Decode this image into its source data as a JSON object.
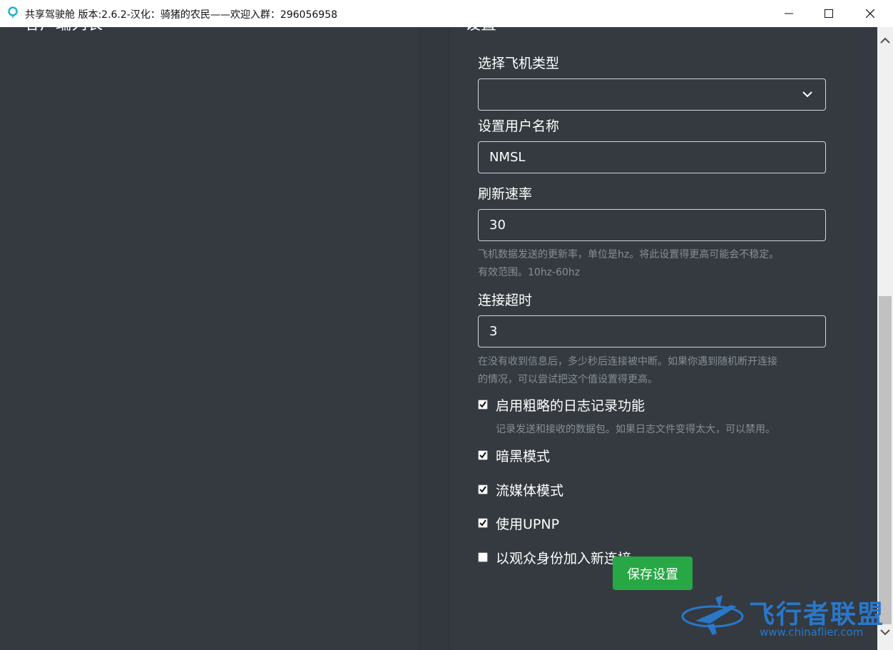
{
  "window": {
    "title": "共享驾驶舱 版本:2.6.2-汉化：骑猪的农民——欢迎入群：296056958",
    "minimize_icon": "minimize-icon",
    "maximize_icon": "maximize-icon",
    "close_icon": "close-icon"
  },
  "left_panel": {
    "heading": "客户端列表"
  },
  "settings": {
    "heading": "设置",
    "aircraft_type": {
      "label": "选择飞机类型",
      "value": ""
    },
    "username": {
      "label": "设置用户名称",
      "value": "NMSL"
    },
    "refresh_rate": {
      "label": "刷新速率",
      "value": "30",
      "help_line1": "飞机数据发送的更新率，单位是hz。将此设置得更高可能会不稳定。",
      "help_line2": "有效范围。10hz-60hz"
    },
    "timeout": {
      "label": "连接超时",
      "value": "3",
      "help_line1": "在没有收到信息后，多少秒后连接被中断。如果你遇到随机断开连接",
      "help_line2": "的情况，可以尝试把这个值设置得更高。"
    },
    "checks": [
      {
        "label": "启用粗略的日志记录功能",
        "checked": true
      },
      {
        "label": "暗黑模式",
        "checked": true
      },
      {
        "label": "流媒体模式",
        "checked": true
      },
      {
        "label": "使用UPNP",
        "checked": true
      },
      {
        "label": "以观众身份加入新连接",
        "checked": false
      }
    ],
    "log_help": "记录发送和接收的数据包。如果日志文件变得太大，可以禁用。",
    "save_label": "保存设置"
  },
  "watermark": {
    "name": "飞行者联盟",
    "url": "www.chinaflier.com"
  },
  "colors": {
    "background": "#343a40",
    "save_button": "#28a745",
    "watermark": "#2a77c9"
  }
}
